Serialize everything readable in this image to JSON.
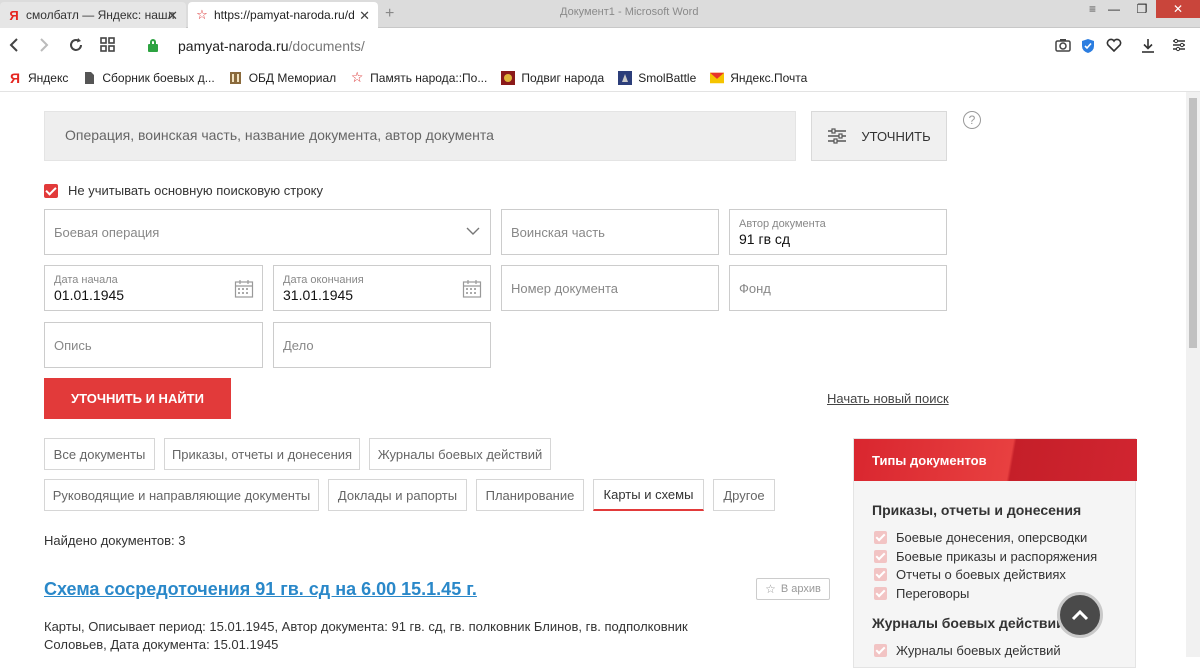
{
  "browser": {
    "tabs": [
      {
        "title": "смолбатл — Яндекс: нашл",
        "favicon": "yandex-icon"
      },
      {
        "title": "https://pamyat-naroda.ru/d",
        "favicon": "star-icon"
      }
    ],
    "window_title": "Документ1 - Microsoft Word",
    "url_host": "pamyat-naroda.ru",
    "url_path": "/documents/",
    "bookmarks": [
      {
        "label": "Яндекс",
        "icon": "yandex-icon"
      },
      {
        "label": "Сборник боевых д...",
        "icon": "document-icon"
      },
      {
        "label": "ОБД Мемориал",
        "icon": "memorial-icon"
      },
      {
        "label": "Память народа::По...",
        "icon": "star-icon"
      },
      {
        "label": "Подвиг народа",
        "icon": "medal-icon"
      },
      {
        "label": "SmolBattle",
        "icon": "smolbattle-icon"
      },
      {
        "label": "Яндекс.Почта",
        "icon": "mail-icon"
      }
    ]
  },
  "search": {
    "placeholder": "Операция, воинская часть, название документа, автор документа",
    "refine_label": "УТОЧНИТЬ",
    "help": "?",
    "ignore_main_label": "Не учитывать основную поисковую строку",
    "ignore_main_checked": true
  },
  "filters": {
    "operation": {
      "placeholder": "Боевая операция"
    },
    "unit": {
      "placeholder": "Воинская часть"
    },
    "author": {
      "label": "Автор документа",
      "value": "91 гв сд"
    },
    "date_from": {
      "label": "Дата начала",
      "value": "01.01.1945"
    },
    "date_to": {
      "label": "Дата окончания",
      "value": "31.01.1945"
    },
    "doc_number": {
      "placeholder": "Номер документа"
    },
    "fond": {
      "placeholder": "Фонд"
    },
    "opis": {
      "placeholder": "Опись"
    },
    "delo": {
      "placeholder": "Дело"
    },
    "submit_label": "УТОЧНИТЬ И НАЙТИ",
    "new_search_label": "Начать новый поиск"
  },
  "doc_types": [
    {
      "label": "Все документы",
      "active": false
    },
    {
      "label": "Приказы, отчеты и донесения",
      "active": false
    },
    {
      "label": "Журналы боевых действий",
      "active": false
    },
    {
      "label": "Руководящие и направляющие документы",
      "active": false
    },
    {
      "label": "Доклады и рапорты",
      "active": false
    },
    {
      "label": "Планирование",
      "active": false
    },
    {
      "label": "Карты и схемы",
      "active": true
    },
    {
      "label": "Другое",
      "active": false
    }
  ],
  "results": {
    "found_label": "Найдено документов: 3",
    "items": [
      {
        "title": "Схема сосредоточения 91 гв. сд на 6.00 15.1.45 г.",
        "archive_label": "В архив",
        "description": "Карты, Описывает период: 15.01.1945, Автор документа: 91 гв. сд, гв. полковник Блинов, гв. подполковник Соловьев, Дата документа: 15.01.1945"
      }
    ]
  },
  "side_panel": {
    "title": "Типы документов",
    "sections": [
      {
        "title": "Приказы, отчеты и донесения",
        "items": [
          "Боевые донесения, оперсводки",
          "Боевые приказы и распоряжения",
          "Отчеты о боевых действиях",
          "Переговоры"
        ]
      },
      {
        "title": "Журналы боевых действий",
        "items": [
          "Журналы боевых действий"
        ]
      }
    ]
  },
  "colors": {
    "accent": "#e23a3a",
    "link": "#2a88c9",
    "secure": "#2da341"
  }
}
